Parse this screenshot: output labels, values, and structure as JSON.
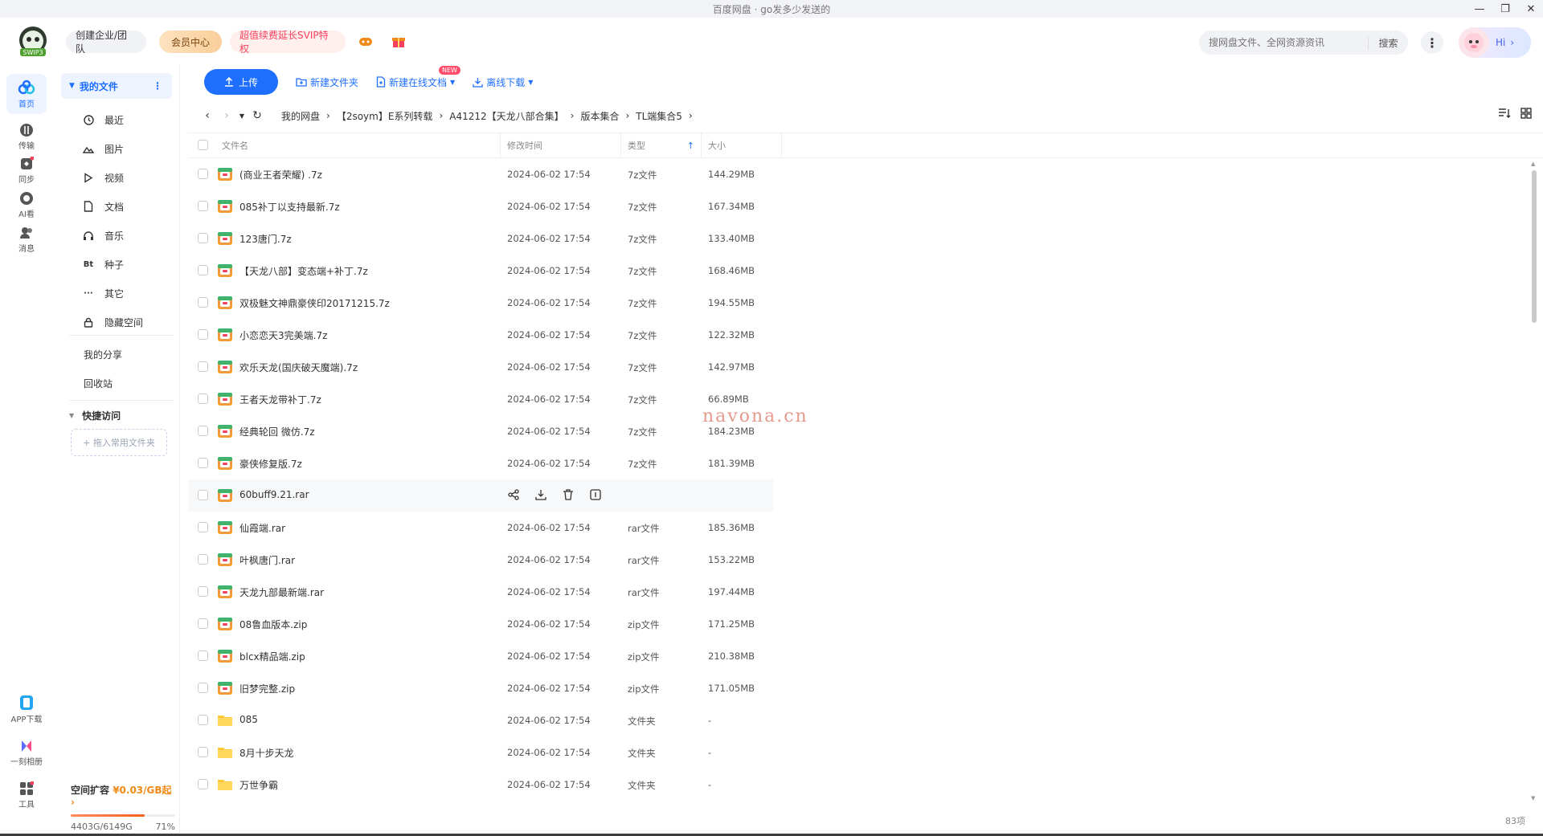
{
  "window": {
    "title": "百度网盘 · go发多少发送的"
  },
  "header": {
    "team_label": "创建企业/团队",
    "vip_label": "会员中心",
    "svip_label": "超值续费延长SVIP特权",
    "search_placeholder": "搜网盘文件、全网资源资讯",
    "search_button": "搜索",
    "hi_label": "Hi",
    "logo_text": "SWIP3"
  },
  "rail": [
    {
      "label": "首页",
      "icon": "home-icon"
    },
    {
      "label": "传输",
      "icon": "transfer-icon"
    },
    {
      "label": "同步",
      "icon": "sync-icon"
    },
    {
      "label": "AI看",
      "icon": "ai-icon"
    },
    {
      "label": "消息",
      "icon": "message-icon"
    },
    {
      "label": "APP下载",
      "icon": "app-download-icon"
    },
    {
      "label": "一刻相册",
      "icon": "album-icon"
    },
    {
      "label": "工具",
      "icon": "tools-icon"
    }
  ],
  "sidebar": {
    "my_files": "我的文件",
    "items": [
      {
        "label": "最近",
        "icon": "clock-icon"
      },
      {
        "label": "图片",
        "icon": "image-icon"
      },
      {
        "label": "视频",
        "icon": "video-icon"
      },
      {
        "label": "文档",
        "icon": "document-icon"
      },
      {
        "label": "音乐",
        "icon": "music-icon"
      },
      {
        "label": "种子",
        "icon": "bt-icon"
      },
      {
        "label": "其它",
        "icon": "more-icon"
      },
      {
        "label": "隐藏空间",
        "icon": "lock-icon"
      }
    ],
    "my_share": "我的分享",
    "recycle": "回收站",
    "quick_access": "快捷访问",
    "drag_hint": "+ 拖入常用文件夹",
    "quota": {
      "title": "空间扩容",
      "price": "¥0.03/GB起",
      "used": "4403G/6149G",
      "percent_label": "71%",
      "percent": 0.71
    }
  },
  "toolbar": {
    "upload": "上传",
    "new_folder": "新建文件夹",
    "new_doc": "新建在线文档",
    "new_tag": "NEW",
    "offline": "离线下载"
  },
  "breadcrumb": [
    "我的网盘",
    "【2soym】E系列转载",
    "A41212【天龙八部合集】",
    "版本集合",
    "TL端集合5"
  ],
  "table": {
    "headers": {
      "name": "文件名",
      "time": "修改时间",
      "type": "类型",
      "size": "大小"
    },
    "rows": [
      {
        "name": "(商业王者荣耀) .7z",
        "time": "2024-06-02 17:54",
        "type": "7z文件",
        "size": "144.29MB",
        "kind": "archive"
      },
      {
        "name": "085补丁以支持最新.7z",
        "time": "2024-06-02 17:54",
        "type": "7z文件",
        "size": "167.34MB",
        "kind": "archive"
      },
      {
        "name": "123唐门.7z",
        "time": "2024-06-02 17:54",
        "type": "7z文件",
        "size": "133.40MB",
        "kind": "archive"
      },
      {
        "name": "【天龙八部】变态端+补丁.7z",
        "time": "2024-06-02 17:54",
        "type": "7z文件",
        "size": "168.46MB",
        "kind": "archive"
      },
      {
        "name": "双极魅文神鼎豪侠印20171215.7z",
        "time": "2024-06-02 17:54",
        "type": "7z文件",
        "size": "194.55MB",
        "kind": "archive"
      },
      {
        "name": "小恋恋天3完美端.7z",
        "time": "2024-06-02 17:54",
        "type": "7z文件",
        "size": "122.32MB",
        "kind": "archive"
      },
      {
        "name": "欢乐天龙(国庆破天魔端).7z",
        "time": "2024-06-02 17:54",
        "type": "7z文件",
        "size": "142.97MB",
        "kind": "archive"
      },
      {
        "name": "王者天龙带补丁.7z",
        "time": "2024-06-02 17:54",
        "type": "7z文件",
        "size": "66.89MB",
        "kind": "archive"
      },
      {
        "name": "经典轮回 微仿.7z",
        "time": "2024-06-02 17:54",
        "type": "7z文件",
        "size": "184.23MB",
        "kind": "archive"
      },
      {
        "name": "豪侠修复版.7z",
        "time": "2024-06-02 17:54",
        "type": "7z文件",
        "size": "181.39MB",
        "kind": "archive"
      },
      {
        "name": "60buff9.21.rar",
        "time": "",
        "type": "",
        "size": "",
        "kind": "archive",
        "hover": true
      },
      {
        "name": "仙霞端.rar",
        "time": "2024-06-02 17:54",
        "type": "rar文件",
        "size": "185.36MB",
        "kind": "archive"
      },
      {
        "name": "叶枫唐门.rar",
        "time": "2024-06-02 17:54",
        "type": "rar文件",
        "size": "153.22MB",
        "kind": "archive"
      },
      {
        "name": "天龙九部最新端.rar",
        "time": "2024-06-02 17:54",
        "type": "rar文件",
        "size": "197.44MB",
        "kind": "archive"
      },
      {
        "name": "08鲁血版本.zip",
        "time": "2024-06-02 17:54",
        "type": "zip文件",
        "size": "171.25MB",
        "kind": "archive"
      },
      {
        "name": "blcx精品端.zip",
        "time": "2024-06-02 17:54",
        "type": "zip文件",
        "size": "210.38MB",
        "kind": "archive"
      },
      {
        "name": "旧梦完整.zip",
        "time": "2024-06-02 17:54",
        "type": "zip文件",
        "size": "171.05MB",
        "kind": "archive"
      },
      {
        "name": "085",
        "time": "2024-06-02 17:54",
        "type": "文件夹",
        "size": "-",
        "kind": "folder"
      },
      {
        "name": "8月十步天龙",
        "time": "2024-06-02 17:54",
        "type": "文件夹",
        "size": "-",
        "kind": "folder"
      },
      {
        "name": "万世争霸",
        "time": "2024-06-02 17:54",
        "type": "文件夹",
        "size": "-",
        "kind": "folder"
      }
    ],
    "count": "83项"
  },
  "watermark": "navona.cn",
  "colors": {
    "accent": "#1f6fff",
    "svip": "#f5415c",
    "vip": "#7a3f0c",
    "quota_price": "#f08a19"
  }
}
